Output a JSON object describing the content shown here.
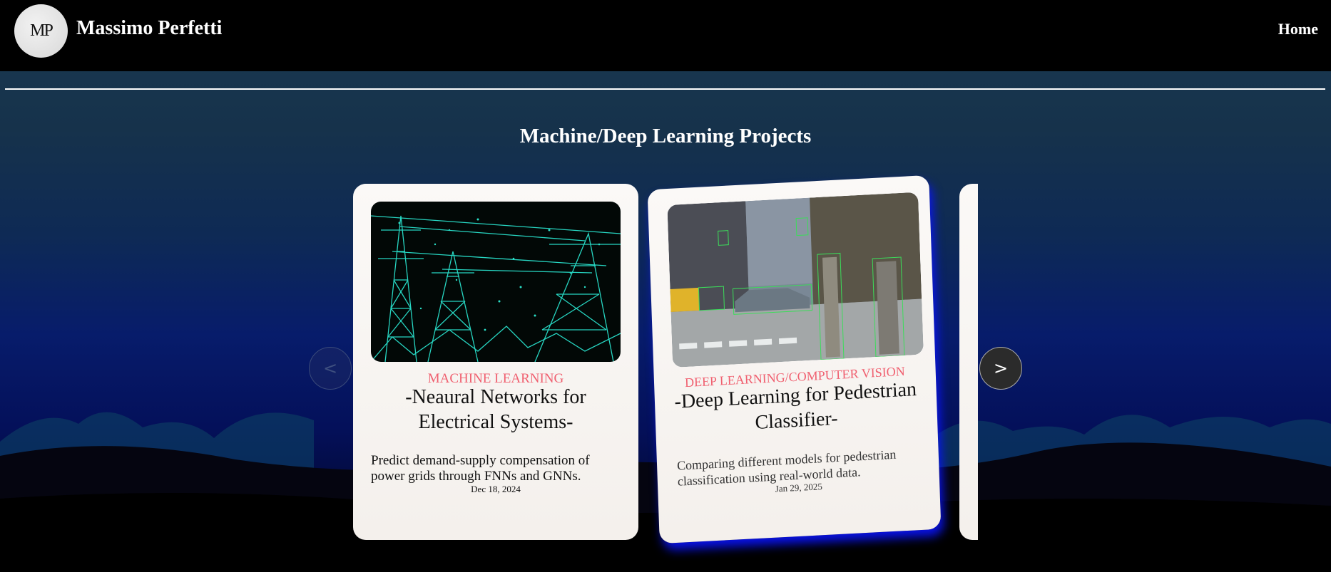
{
  "header": {
    "logo_text": "MP",
    "site_name": "Massimo Perfetti",
    "nav_home": "Home"
  },
  "section": {
    "title": "Machine/Deep Learning Projects"
  },
  "carousel": {
    "prev_label": "<",
    "next_label": ">",
    "cards": [
      {
        "category": "MACHINE LEARNING",
        "title": "-Neaural Networks for Electrical Systems-",
        "description": "Predict demand-supply compensation of power grids through FNNs and GNNs.",
        "date": "Dec 18, 2024",
        "image": "power-grid-towers-illustration"
      },
      {
        "category": "DEEP LEARNING/COMPUTER VISION",
        "title": "-Deep Learning for Pedestrian Classifier-",
        "description": "Comparing different models for pedestrian classification using real-world data.",
        "date": "Jan 29, 2025",
        "image": "street-object-detection-photo"
      }
    ]
  },
  "colors": {
    "category_accent": "#f06070",
    "card_glow": "#0a14ff",
    "tower_cyan": "#27d6c2"
  }
}
